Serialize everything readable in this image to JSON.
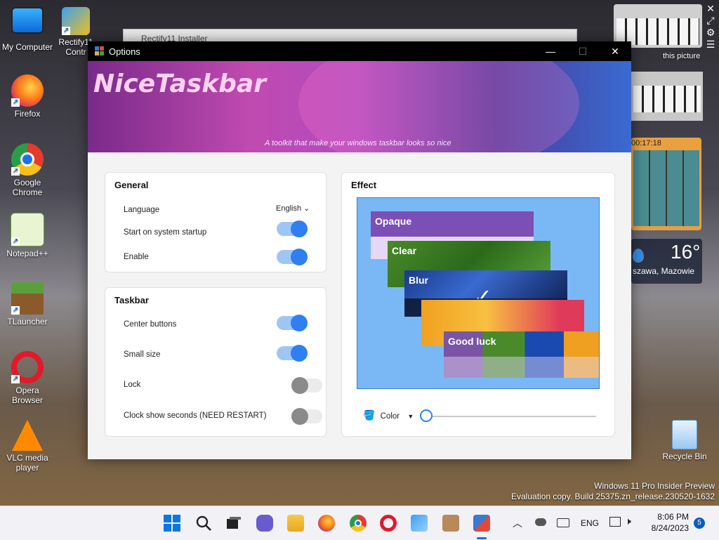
{
  "desktop": {
    "icons": [
      {
        "label": "My Computer",
        "icon": "monitor-icon"
      },
      {
        "label": "Rectify11 Contr",
        "icon": "rectify-icon"
      },
      {
        "label": "Firefox",
        "icon": "firefox-icon"
      },
      {
        "label": "Google Chrome",
        "icon": "chrome-icon"
      },
      {
        "label": "Notepad++",
        "icon": "notepadpp-icon"
      },
      {
        "label": "TLauncher",
        "icon": "tlauncher-icon"
      },
      {
        "label": "Opera Browser",
        "icon": "opera-icon"
      },
      {
        "label": "VLC media player",
        "icon": "vlc-icon"
      },
      {
        "label": "Recycle Bin",
        "icon": "recycle-bin-icon"
      }
    ],
    "background_window_title": "Rectify11 Installer",
    "watermark_line1": "Windows 11 Pro Insider Preview",
    "watermark_line2": "Evaluation copy. Build 25375.zn_release.230520-1632",
    "widget_picture_label": "this picture",
    "widget_timer": "00:17:18",
    "weather_temp": "16°",
    "weather_location": "szawa, Mazowie"
  },
  "window": {
    "title": "Options",
    "minimize": "—",
    "maximize": "☐",
    "close": "✕",
    "banner_title": "NiceTaskbar",
    "banner_subtitle": "A toolkit that make your windows taskbar looks so nice"
  },
  "general": {
    "heading": "General",
    "language_label": "Language",
    "language_value": "English",
    "startup_label": "Start on system startup",
    "startup_on": true,
    "enable_label": "Enable",
    "enable_on": true
  },
  "taskbar_settings": {
    "heading": "Taskbar",
    "center_label": "Center buttons",
    "center_on": true,
    "small_label": "Small size",
    "small_on": true,
    "lock_label": "Lock",
    "lock_on": false,
    "seconds_label": "Clock show seconds (NEED RESTART)",
    "seconds_on": false
  },
  "effect": {
    "heading": "Effect",
    "modes": [
      "Opaque",
      "Clear",
      "Blur",
      "Good luck"
    ],
    "color_label": "Color",
    "slider_value": 0
  },
  "taskbar": {
    "language": "ENG",
    "time": "8:06 PM",
    "date": "8/24/2023",
    "notification_count": "5"
  },
  "colors": {
    "accent": "#2f7ff0",
    "preview_bg": "#7ab8f5",
    "opaque_bar": "#7b4fb5"
  }
}
